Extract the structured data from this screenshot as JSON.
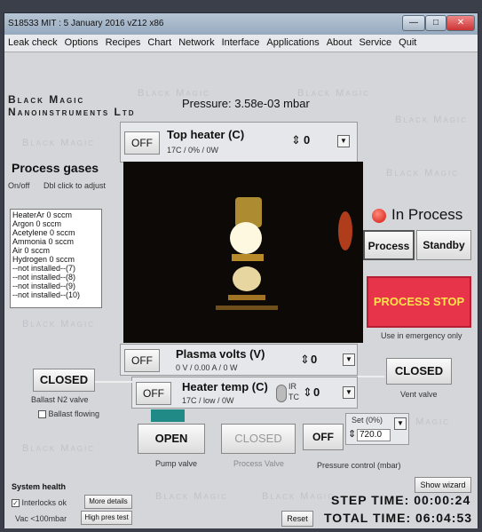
{
  "window": {
    "title": "S18533 MIT : 5 January 2016 vZ12 x86"
  },
  "menu": [
    "Leak check",
    "Options",
    "Recipes",
    "Chart",
    "Network",
    "Interface",
    "Applications",
    "About",
    "Service",
    "Quit"
  ],
  "brand": {
    "line1": "Black Magic",
    "line2": "Nanoinstruments Ltd",
    "watermark": "Black Magic"
  },
  "pressure": "Pressure: 3.58e-03 mbar",
  "gases": {
    "title": "Process gases",
    "hint_left": "On/off",
    "hint_right": "Dbl click to adjust",
    "items": [
      "HeaterAr 0 sccm",
      "Argon 0 sccm",
      "Acetylene 0 sccm",
      "Ammonia 0 sccm",
      "Air 0 sccm",
      "Hydrogen 0 sccm",
      "--not installed--(7)",
      "--not installed--(8)",
      "--not installed--(9)",
      "--not installed--(10)"
    ]
  },
  "top_heater": {
    "toggle": "OFF",
    "title": "Top heater (C)",
    "readout": "17C / 0% / 0W",
    "value": "0"
  },
  "plasma": {
    "toggle": "OFF",
    "title": "Plasma volts (V)",
    "readout": "0 V / 0.00 A / 0 W",
    "value": "0"
  },
  "heater_temp": {
    "toggle": "OFF",
    "title": "Heater temp (C)",
    "readout": "17C / low / 0W",
    "sensor_ir": "IR",
    "sensor_tc": "TC",
    "value": "0"
  },
  "status": {
    "label": "In Process",
    "led_color": "#d3150e"
  },
  "mode": {
    "process": "Process",
    "standby": "Standby"
  },
  "stop": {
    "label": "PROCESS STOP",
    "caption": "Use in emergency only"
  },
  "ballast": {
    "state": "CLOSED",
    "caption": "Ballast N2 valve",
    "check_label": "Ballast flowing"
  },
  "vent": {
    "state": "CLOSED",
    "caption": "Vent valve"
  },
  "pump": {
    "state": "OPEN",
    "caption": "Pump valve"
  },
  "process_valve": {
    "state": "CLOSED",
    "caption": "Process Valve"
  },
  "pressure_control": {
    "toggle": "OFF",
    "set_label": "Set (0%)",
    "value": "720.0",
    "caption": "Pressure control (mbar)"
  },
  "wizard": "Show wizard",
  "health": {
    "title": "System health",
    "interlocks": "Interlocks ok",
    "more": "More details",
    "vac": "Vac <100mbar",
    "high_pres": "High pres test"
  },
  "reset": "Reset",
  "step_time": "STEP TIME: 00:00:24",
  "total_time": "TOTAL TIME: 06:04:53"
}
